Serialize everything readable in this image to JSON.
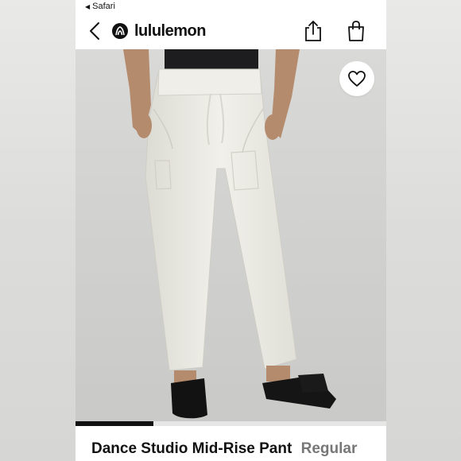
{
  "status_bar": {
    "back_app": "Safari"
  },
  "header": {
    "brand": "lululemon",
    "icons": {
      "back": "chevron-left-icon",
      "share": "share-icon",
      "bag": "shopping-bag-icon"
    }
  },
  "product": {
    "name": "Dance Studio Mid-Rise Pant",
    "fit": "Regular",
    "image_progress": 0.25
  },
  "colors": {
    "accent": "#111111",
    "pant": "#ecebe5",
    "background": "#d4d4d2"
  }
}
